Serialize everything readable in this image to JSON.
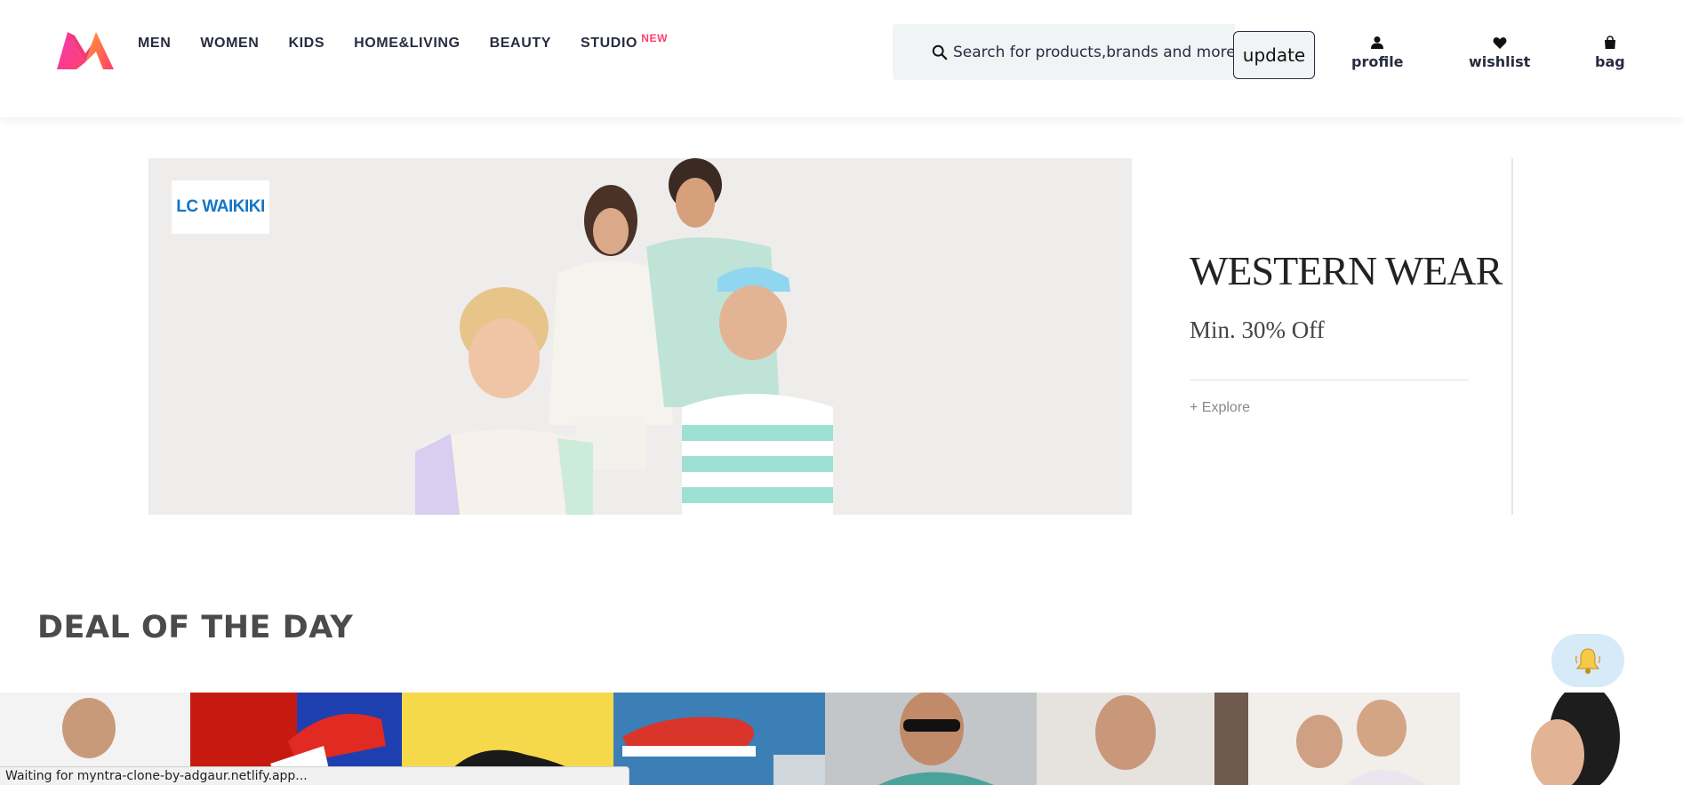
{
  "header": {
    "logo_icon": "myntra-logo",
    "nav": [
      {
        "label": "MEN"
      },
      {
        "label": "WOMEN"
      },
      {
        "label": "KIDS"
      },
      {
        "label": "HOME&LIVING"
      },
      {
        "label": "BEAUTY"
      },
      {
        "label": "STUDIO",
        "badge": "NEW"
      }
    ],
    "search": {
      "placeholder": "Search for products,brands and more",
      "icon": "search-icon"
    },
    "update_button": "update",
    "actions": [
      {
        "label": "profile",
        "icon": "person-icon"
      },
      {
        "label": "wishlist",
        "icon": "heart-icon"
      },
      {
        "label": "bag",
        "icon": "bag-icon"
      }
    ]
  },
  "banner": {
    "brand": "LC WAIKIKI",
    "title": "WESTERN WEAR",
    "subtitle": "Min. 30% Off",
    "explore": "+ Explore"
  },
  "deal_section": {
    "title": "DEAL OF THE DAY",
    "notification_icon": "bell-icon"
  },
  "status_bar": "Waiting for myntra-clone-by-adgaur.netlify.app...",
  "colors": {
    "accent": "#ff3f6c",
    "text": "#282c3f",
    "search_bg": "#f0f4f5"
  }
}
